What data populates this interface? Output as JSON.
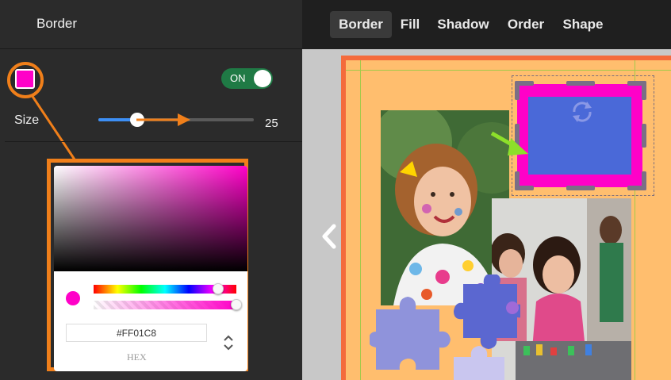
{
  "left_panel": {
    "title": "Border",
    "border_color": "#FF01C8",
    "toggle": {
      "label": "ON",
      "state": true,
      "color": "#1f7a45"
    },
    "size": {
      "label": "Size",
      "value": "25",
      "fraction": 0.25
    }
  },
  "color_picker": {
    "hex_value": "#FF01C8",
    "mode_label": "HEX",
    "hue_fraction": 0.87,
    "alpha_fraction": 1.0
  },
  "toolbar": {
    "tabs": [
      {
        "label": "Border",
        "active": true
      },
      {
        "label": "Fill",
        "active": false
      },
      {
        "label": "Shadow",
        "active": false
      },
      {
        "label": "Order",
        "active": false
      },
      {
        "label": "Shape",
        "active": false
      }
    ]
  },
  "canvas": {
    "page_background": "#ffbe6e",
    "page_border_color": "#f46b3c",
    "frame_border_color": "#ff01c8",
    "frame_fill_color": "#4a69d8",
    "annotation_color": "#f07f1a",
    "pointer_arrow_color": "#8de02a"
  }
}
